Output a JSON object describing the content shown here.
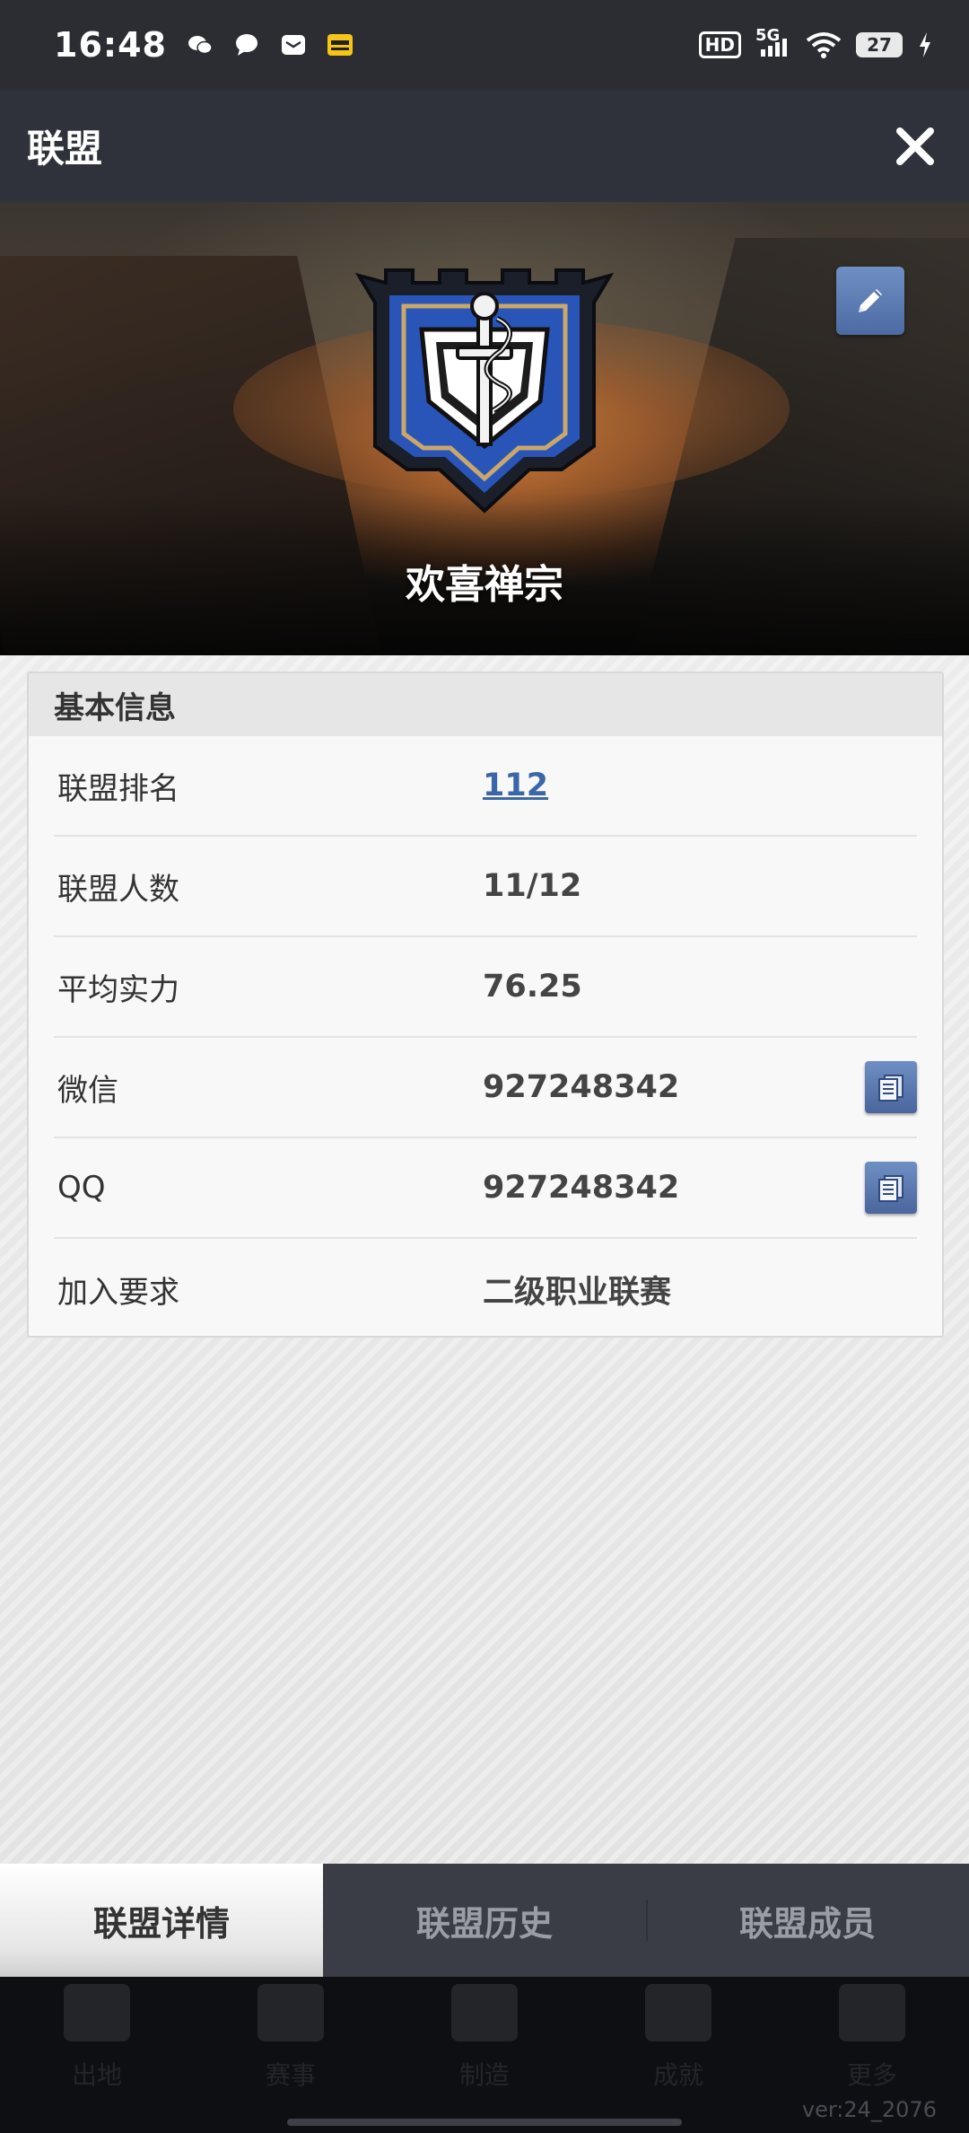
{
  "status_bar": {
    "time": "16:48",
    "notification_icons": [
      "wechat-icon",
      "chat-bubble-icon",
      "mail-icon",
      "app-badge-icon"
    ],
    "hd_label": "HD",
    "network_label": "5G",
    "battery_level": "27"
  },
  "header": {
    "title": "联盟"
  },
  "hero": {
    "guild_name": "欢喜禅宗"
  },
  "basic_info": {
    "section_title": "基本信息",
    "rows": [
      {
        "label": "联盟排名",
        "value": "112"
      },
      {
        "label": "联盟人数",
        "value": "11/12"
      },
      {
        "label": "平均实力",
        "value": "76.25"
      },
      {
        "label": "微信",
        "value": "927248342"
      },
      {
        "label": "QQ",
        "value": "927248342"
      },
      {
        "label": "加入要求",
        "value": "二级职业联赛"
      }
    ]
  },
  "tabs": [
    {
      "label": "联盟详情",
      "active": true
    },
    {
      "label": "联盟历史",
      "active": false
    },
    {
      "label": "联盟成员",
      "active": false
    }
  ],
  "bottom_nav": {
    "items": [
      "出地",
      "赛事",
      "制造",
      "成就",
      "更多"
    ]
  },
  "version": "ver:24_2076",
  "colors": {
    "accent_blue": "#3b67a8",
    "button_blue": "#5a78b0",
    "title_bar": "#2f323b",
    "tab_bar": "#3a3d45"
  }
}
